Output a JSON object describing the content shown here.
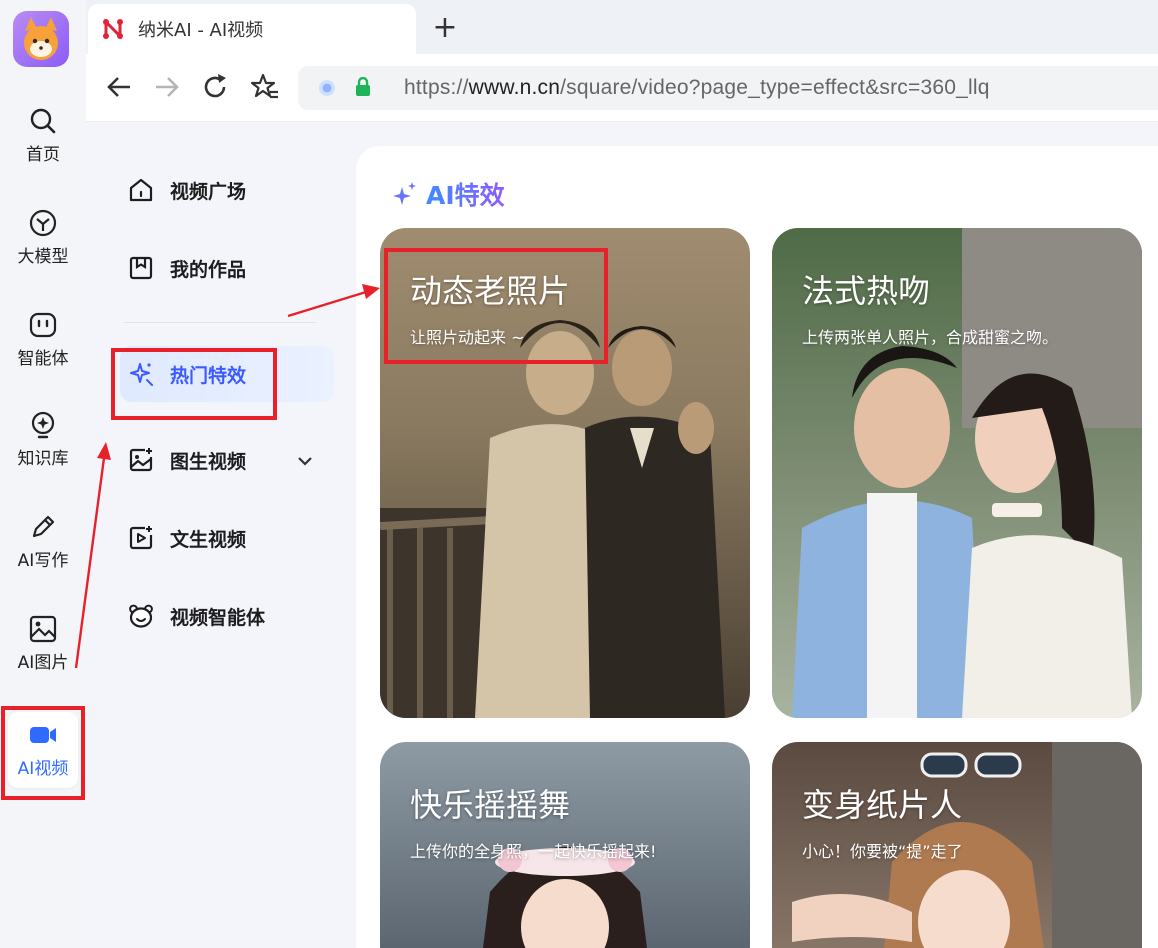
{
  "rail": {
    "items": [
      {
        "label": "首页",
        "icon": "search-icon"
      },
      {
        "label": "大模型",
        "icon": "cube-icon"
      },
      {
        "label": "智能体",
        "icon": "agent-icon"
      },
      {
        "label": "知识库",
        "icon": "bulb-icon"
      },
      {
        "label": "AI写作",
        "icon": "pen-icon"
      },
      {
        "label": "AI图片",
        "icon": "image-icon"
      },
      {
        "label": "AI视频",
        "icon": "video-icon"
      }
    ],
    "active_color": "#2f6bff"
  },
  "browser": {
    "tab_title": "纳米AI - AI视频",
    "new_tab": "+",
    "url_prefix": "https://",
    "url_domain": "www.n.cn",
    "url_path": "/square/video?page_type=effect&src=360_llq"
  },
  "subnav": {
    "items": [
      {
        "label": "视频广场"
      },
      {
        "label": "我的作品"
      },
      {
        "label": "热门特效"
      },
      {
        "label": "图生视频"
      },
      {
        "label": "文生视频"
      },
      {
        "label": "视频智能体"
      }
    ]
  },
  "content": {
    "section_title": "AI特效",
    "cards": [
      {
        "title": "动态老照片",
        "subtitle": "让照片动起来 ~"
      },
      {
        "title": "法式热吻",
        "subtitle": "上传两张单人照片，合成甜蜜之吻。"
      },
      {
        "title": "快乐摇摇舞",
        "subtitle": "上传你的全身照，一起快乐摇起来!"
      },
      {
        "title": "变身纸片人",
        "subtitle": "小心！你要被“提”走了"
      }
    ]
  },
  "annotation_color": "#e8202a"
}
